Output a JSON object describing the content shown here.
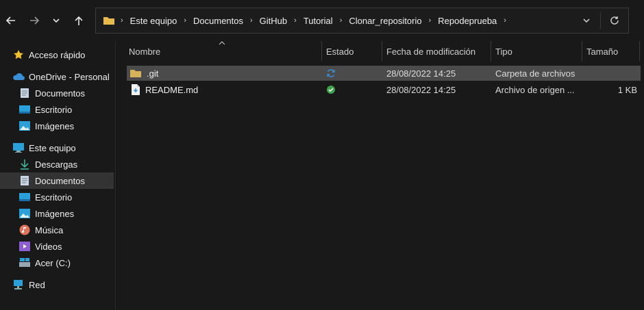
{
  "nav": {
    "back": "back",
    "forward": "forward",
    "recent": "recent-locations",
    "up": "up"
  },
  "address": {
    "crumbs": [
      "Este equipo",
      "Documentos",
      "GitHub",
      "Tutorial",
      "Clonar_repositorio",
      "Repodeprueba"
    ],
    "dropdown_icon": "chevron-down-icon",
    "refresh_icon": "refresh-icon"
  },
  "sidebar": {
    "quick_access": "Acceso rápido",
    "onedrive": {
      "label": "OneDrive - Personal",
      "items": [
        "Documentos",
        "Escritorio",
        "Imágenes"
      ]
    },
    "this_pc": {
      "label": "Este equipo",
      "items": [
        "Descargas",
        "Documentos",
        "Escritorio",
        "Imágenes",
        "Música",
        "Videos",
        "Acer (C:)"
      ]
    },
    "network": "Red"
  },
  "columns": {
    "name": "Nombre",
    "status": "Estado",
    "modified": "Fecha de modificación",
    "type": "Tipo",
    "size": "Tamaño"
  },
  "files": [
    {
      "name": ".git",
      "status": "sync",
      "modified": "28/08/2022 14:25",
      "type": "Carpeta de archivos",
      "size": ""
    },
    {
      "name": "README.md",
      "status": "ok",
      "modified": "28/08/2022 14:25",
      "type": "Archivo de origen ...",
      "size": "1 KB"
    }
  ],
  "colors": {
    "background": "#191919",
    "selected": "#4b4b4b",
    "accent": "#3b8fd6",
    "folder": "#d8b25a",
    "status_ok": "#3fa14a"
  }
}
